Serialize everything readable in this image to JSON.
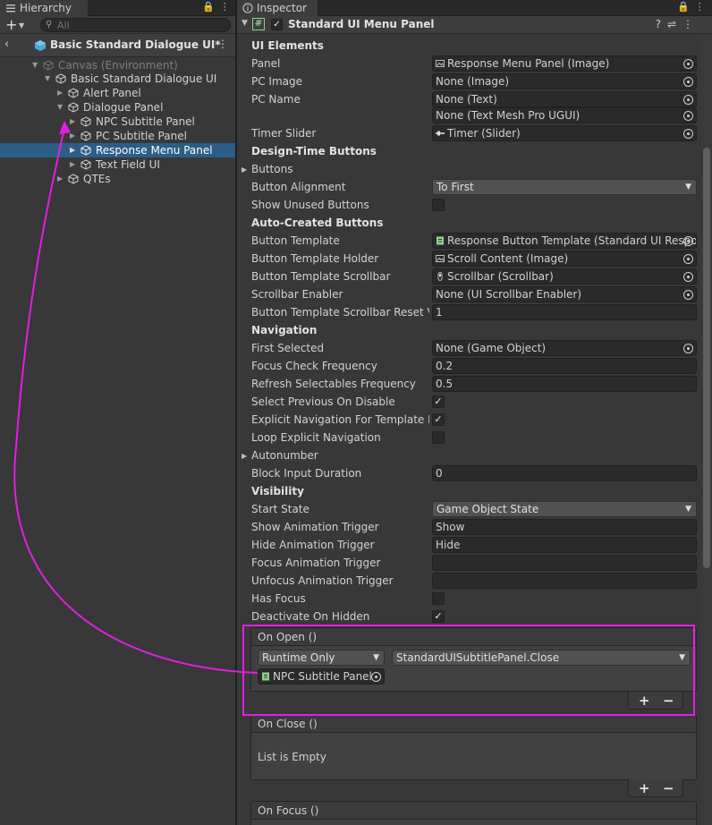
{
  "hierarchy": {
    "tab_label": "Hierarchy",
    "search_placeholder": "All",
    "scene_title": "Basic Standard Dialogue UI*",
    "items": [
      {
        "label": "Canvas (Environment)"
      },
      {
        "label": "Basic Standard Dialogue UI"
      },
      {
        "label": "Alert Panel"
      },
      {
        "label": "Dialogue Panel"
      },
      {
        "label": "NPC Subtitle Panel"
      },
      {
        "label": "PC Subtitle Panel"
      },
      {
        "label": "Response Menu Panel"
      },
      {
        "label": "Text Field UI"
      },
      {
        "label": "QTEs"
      }
    ],
    "selected": "Response Menu Panel"
  },
  "inspector": {
    "tab_label": "Inspector",
    "component_title": "Standard UI Menu Panel",
    "enabled": true,
    "rows": {
      "ui_elements_header": "UI Elements",
      "panel_label": "Panel",
      "panel_value": "Response Menu Panel (Image)",
      "pc_image_label": "PC Image",
      "pc_image_value": "None (Image)",
      "pc_name_label": "PC Name",
      "pc_name_value": "None (Text)",
      "pc_name_tmp_value": "None (Text Mesh Pro UGUI)",
      "timer_slider_label": "Timer Slider",
      "timer_slider_value": "Timer (Slider)",
      "design_time_header": "Design-Time Buttons",
      "buttons_label": "Buttons",
      "button_alignment_label": "Button Alignment",
      "button_alignment_value": "To First",
      "show_unused_label": "Show Unused Buttons",
      "auto_created_header": "Auto-Created Buttons",
      "button_template_label": "Button Template",
      "button_template_value": "Response Button Template (Standard UI Respo",
      "button_template_holder_label": "Button Template Holder",
      "button_template_holder_value": "Scroll Content (Image)",
      "button_template_scrollbar_label": "Button Template Scrollbar",
      "button_template_scrollbar_value": "Scrollbar (Scrollbar)",
      "scrollbar_enabler_label": "Scrollbar Enabler",
      "scrollbar_enabler_value": "None (UI Scrollbar Enabler)",
      "scrollbar_reset_label": "Button Template Scrollbar Reset Va",
      "scrollbar_reset_value": "1",
      "navigation_header": "Navigation",
      "first_selected_label": "First Selected",
      "first_selected_value": "None (Game Object)",
      "focus_check_label": "Focus Check Frequency",
      "focus_check_value": "0.2",
      "refresh_selectables_label": "Refresh Selectables Frequency",
      "refresh_selectables_value": "0.5",
      "select_previous_label": "Select Previous On Disable",
      "explicit_nav_label": "Explicit Navigation For Template Bu",
      "loop_explicit_label": "Loop Explicit Navigation",
      "autonumber_label": "Autonumber",
      "block_input_label": "Block Input Duration",
      "block_input_value": "0",
      "visibility_header": "Visibility",
      "start_state_label": "Start State",
      "start_state_value": "Game Object State",
      "show_anim_label": "Show Animation Trigger",
      "show_anim_value": "Show",
      "hide_anim_label": "Hide Animation Trigger",
      "hide_anim_value": "Hide",
      "focus_anim_label": "Focus Animation Trigger",
      "focus_anim_value": "",
      "unfocus_anim_label": "Unfocus Animation Trigger",
      "unfocus_anim_value": "",
      "has_focus_label": "Has Focus",
      "deactivate_label": "Deactivate On Hidden"
    },
    "checks": {
      "show_unused": false,
      "select_previous": true,
      "explicit_nav": true,
      "loop_explicit": false,
      "has_focus": false,
      "deactivate": true
    },
    "events": {
      "on_open_title": "On Open ()",
      "on_open_mode": "Runtime Only",
      "on_open_function": "StandardUISubtitlePanel.Close",
      "on_open_target": "NPC Subtitle Panel",
      "on_close_title": "On Close ()",
      "on_close_empty": "List is Empty",
      "on_focus_title": "On Focus ()",
      "plus": "+",
      "minus": "−"
    }
  },
  "colors": {
    "selection": "#2c5d87",
    "highlight": "#e020e0",
    "panel_bg": "#383838"
  }
}
